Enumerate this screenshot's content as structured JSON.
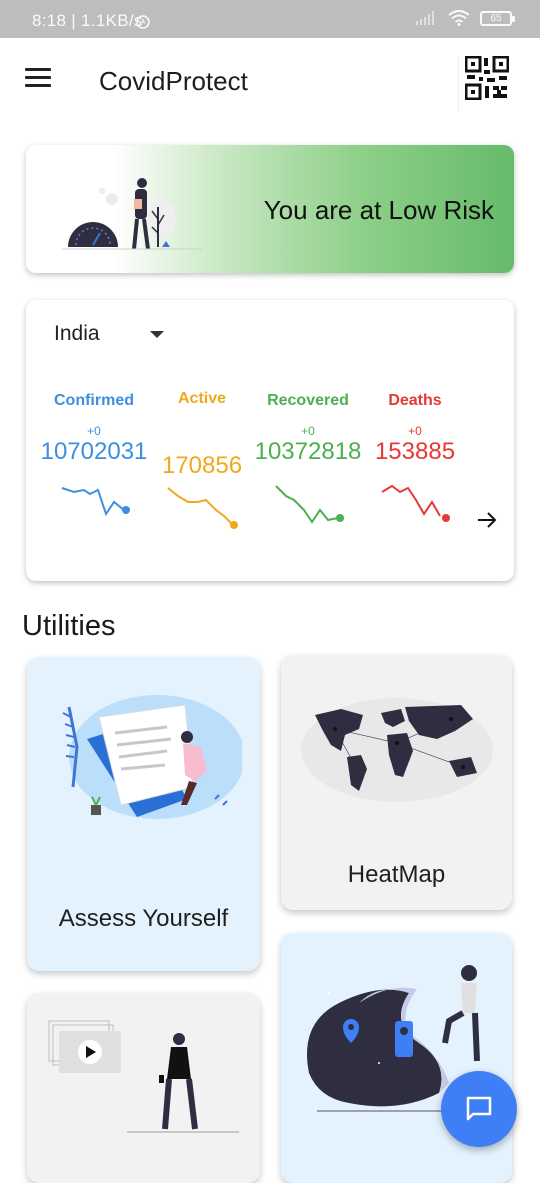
{
  "status_bar": {
    "time_speed": "8:18 | 1.1KB/s",
    "battery": "65"
  },
  "app_bar": {
    "title": "CovidProtect",
    "menu_icon": "hamburger-menu-icon",
    "qr_icon": "qr-code-icon"
  },
  "risk_banner": {
    "text": "You are at Low Risk"
  },
  "stats": {
    "country": "India",
    "columns": [
      {
        "label": "Confirmed",
        "delta": "+0",
        "value": "10702031",
        "color": "#3d8fe0"
      },
      {
        "label": "Active",
        "delta": "",
        "value": "170856",
        "color": "#f2a81d"
      },
      {
        "label": "Recovered",
        "delta": "+0",
        "value": "10372818",
        "color": "#4caf50"
      },
      {
        "label": "Deaths",
        "delta": "+0",
        "value": "153885",
        "color": "#e53935"
      }
    ]
  },
  "utilities": {
    "title": "Utilities",
    "assess_label": "Assess Yourself",
    "heatmap_label": "HeatMap"
  },
  "fab_icon": "chat-icon"
}
